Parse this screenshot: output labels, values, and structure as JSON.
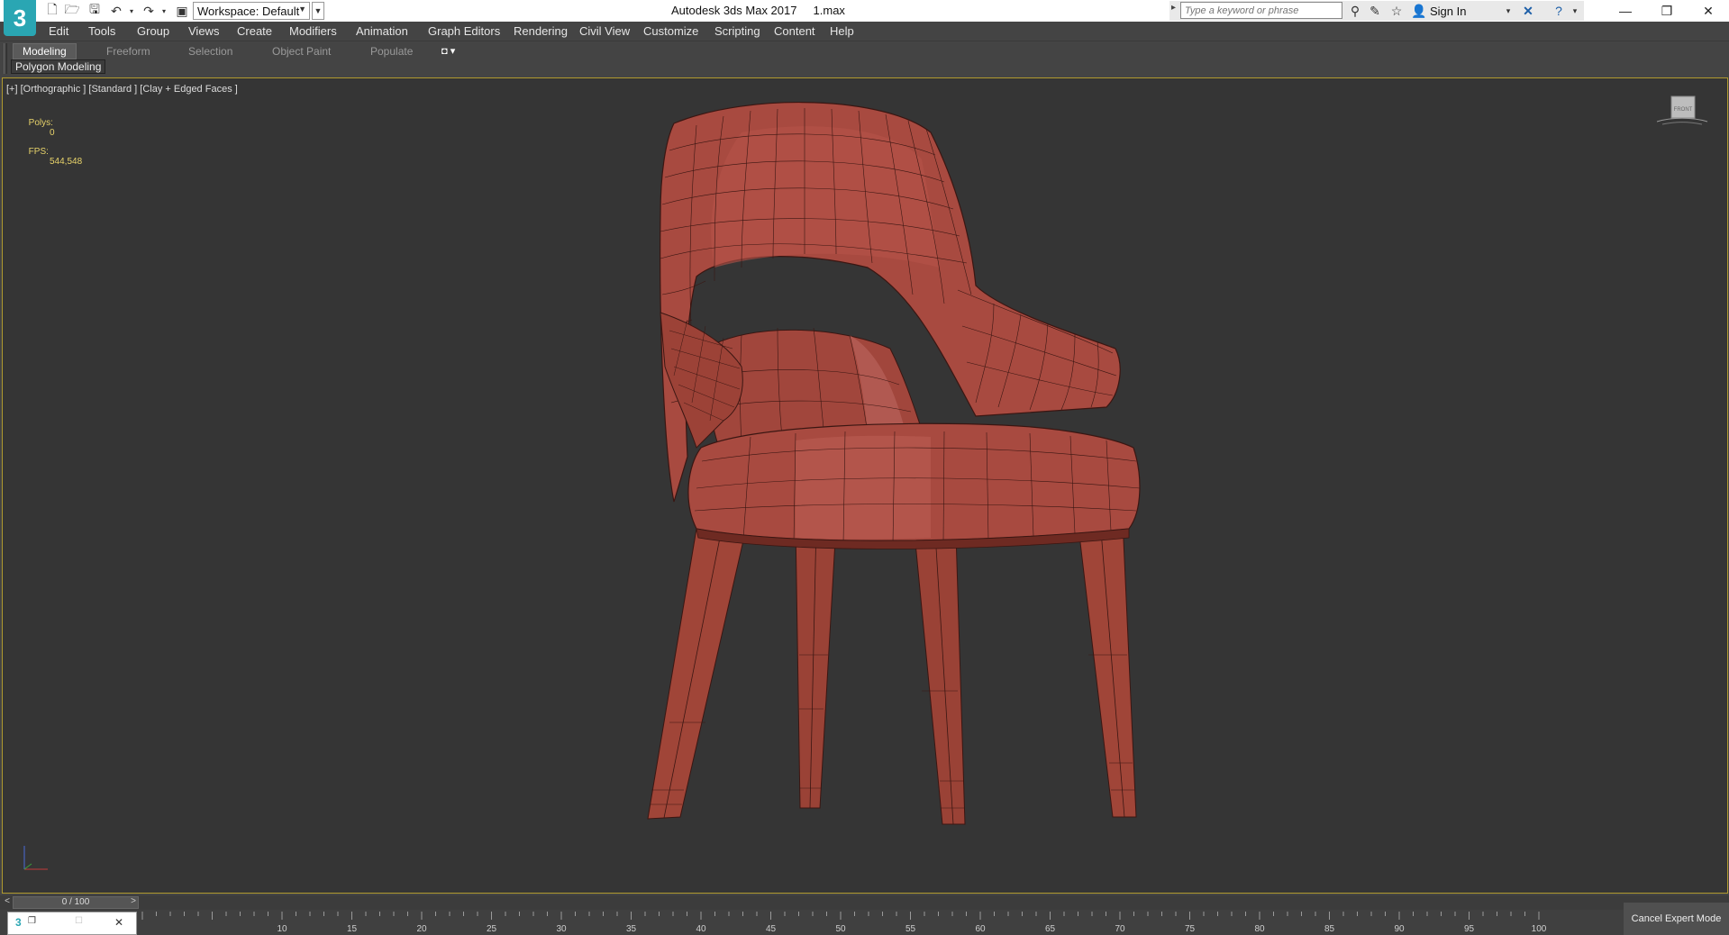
{
  "app": {
    "logo_text": "3",
    "window_title": "Autodesk 3ds Max 2017     1.max",
    "workspace_label": "Workspace: Default"
  },
  "search": {
    "placeholder": "Type a keyword or phrase",
    "signin_label": "Sign In"
  },
  "menu": [
    {
      "label": "Edit"
    },
    {
      "label": "Tools"
    },
    {
      "label": "Group"
    },
    {
      "label": "Views"
    },
    {
      "label": "Create"
    },
    {
      "label": "Modifiers"
    },
    {
      "label": "Animation"
    },
    {
      "label": "Graph Editors"
    },
    {
      "label": "Rendering"
    },
    {
      "label": "Civil View"
    },
    {
      "label": "Customize"
    },
    {
      "label": "Scripting"
    },
    {
      "label": "Content"
    },
    {
      "label": "Help"
    }
  ],
  "ribbon": {
    "tabs": [
      {
        "label": "Modeling",
        "active": true
      },
      {
        "label": "Freeform"
      },
      {
        "label": "Selection"
      },
      {
        "label": "Object Paint"
      },
      {
        "label": "Populate"
      }
    ],
    "panel_label": "Polygon Modeling"
  },
  "viewport": {
    "label": "[+] [Orthographic ] [Standard ] [Clay + Edged Faces ]",
    "stats": {
      "polys_label": "Polys:",
      "polys_value": "0",
      "fps_label": "FPS:",
      "fps_value": "544,548"
    },
    "viewcube_label": "FRONT",
    "object_color": "#a84a40"
  },
  "timeline": {
    "slider_label": "0 / 100",
    "prev_label": "<",
    "next_label": ">",
    "ticks": [
      "10",
      "15",
      "20",
      "25",
      "30",
      "35",
      "40",
      "45",
      "50",
      "55",
      "60",
      "65",
      "70",
      "75",
      "80",
      "85",
      "90",
      "95",
      "100"
    ]
  },
  "status": {
    "cancel_expert_label": "Cancel Expert Mode"
  },
  "colors": {
    "accent": "#2aa6b3",
    "viewport_border": "#b09a2e",
    "stats_text": "#e8d36a"
  }
}
